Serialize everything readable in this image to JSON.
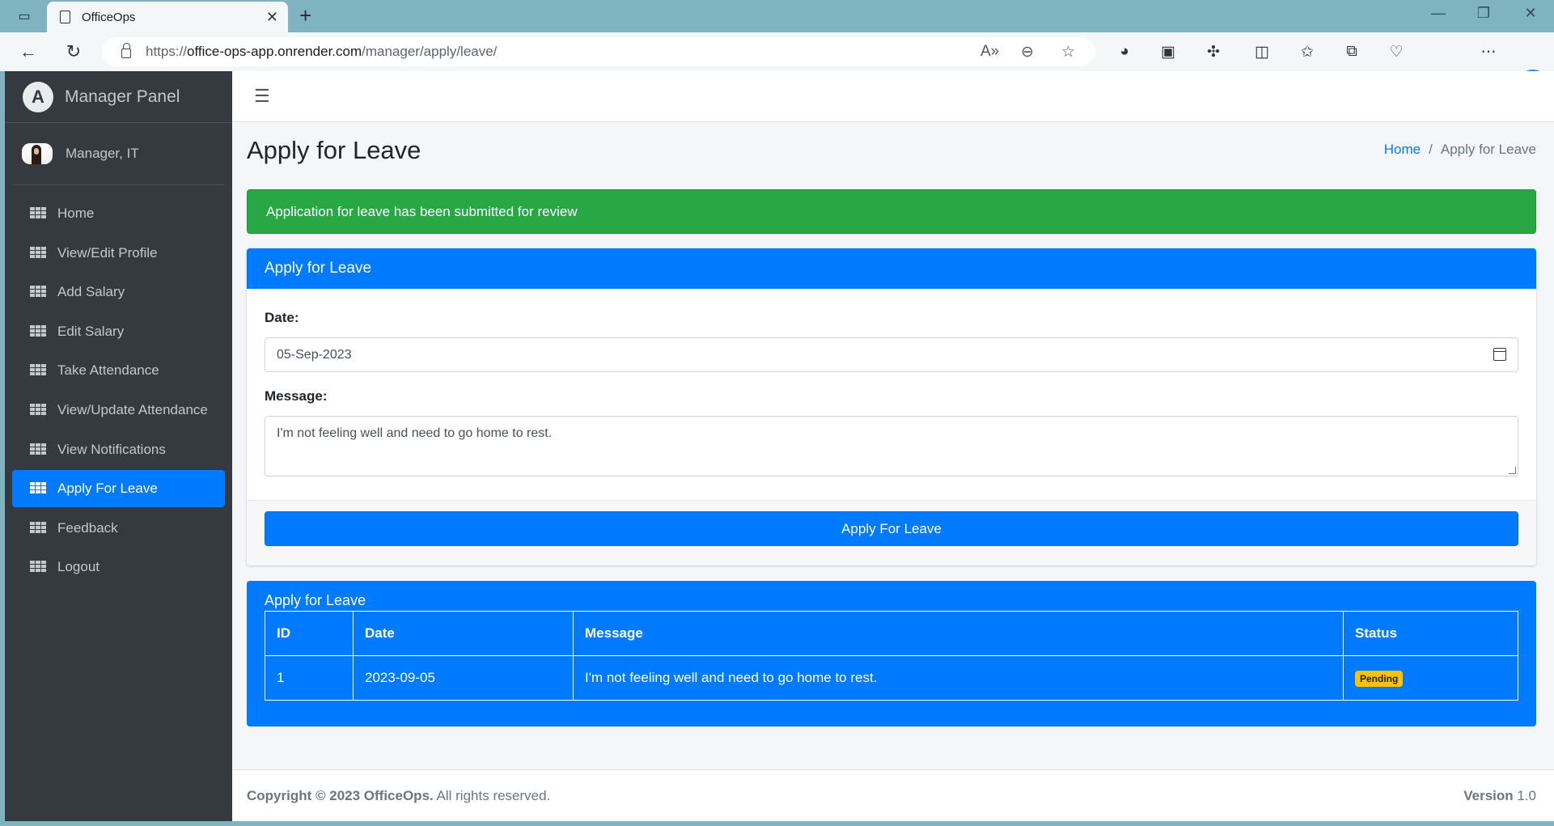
{
  "browser": {
    "tab_title": "OfficeOps",
    "url_prefix": "https://",
    "url_host": "office-ops-app.onrender.com",
    "url_path": "/manager/apply/leave/"
  },
  "sidebar": {
    "brand": "Manager Panel",
    "brand_logo": "A",
    "user_name": "Manager, IT",
    "items": [
      {
        "label": "Home",
        "active": false
      },
      {
        "label": "View/Edit Profile",
        "active": false
      },
      {
        "label": "Add Salary",
        "active": false
      },
      {
        "label": "Edit Salary",
        "active": false
      },
      {
        "label": "Take Attendance",
        "active": false
      },
      {
        "label": "View/Update Attendance",
        "active": false
      },
      {
        "label": "View Notifications",
        "active": false
      },
      {
        "label": "Apply For Leave",
        "active": true
      },
      {
        "label": "Feedback",
        "active": false
      },
      {
        "label": "Logout",
        "active": false
      }
    ]
  },
  "header": {
    "page_title": "Apply for Leave",
    "breadcrumb_home": "Home",
    "breadcrumb_sep": "/",
    "breadcrumb_current": "Apply for Leave"
  },
  "alert": {
    "text": "Application for leave has been submitted for review",
    "color": "#28a745"
  },
  "form": {
    "title": "Apply for Leave",
    "date_label": "Date:",
    "date_value": "05-Sep-2023",
    "message_label": "Message:",
    "message_value": "I'm not feeling well and need to go home to rest.",
    "submit_label": "Apply For Leave"
  },
  "history": {
    "title": "Apply for Leave",
    "columns": [
      "ID",
      "Date",
      "Message",
      "Status"
    ],
    "rows": [
      {
        "id": "1",
        "date": "2023-09-05",
        "message": "I'm not feeling well and need to go home to rest.",
        "status": "Pending"
      }
    ]
  },
  "footer": {
    "copyright_bold": "Copyright © 2023 OfficeOps.",
    "copyright_rest": " All rights reserved.",
    "version_label": "Version",
    "version_value": " 1.0"
  },
  "colors": {
    "primary": "#007bff",
    "sidebar": "#343a40",
    "badge_pending": "#ffc107"
  }
}
